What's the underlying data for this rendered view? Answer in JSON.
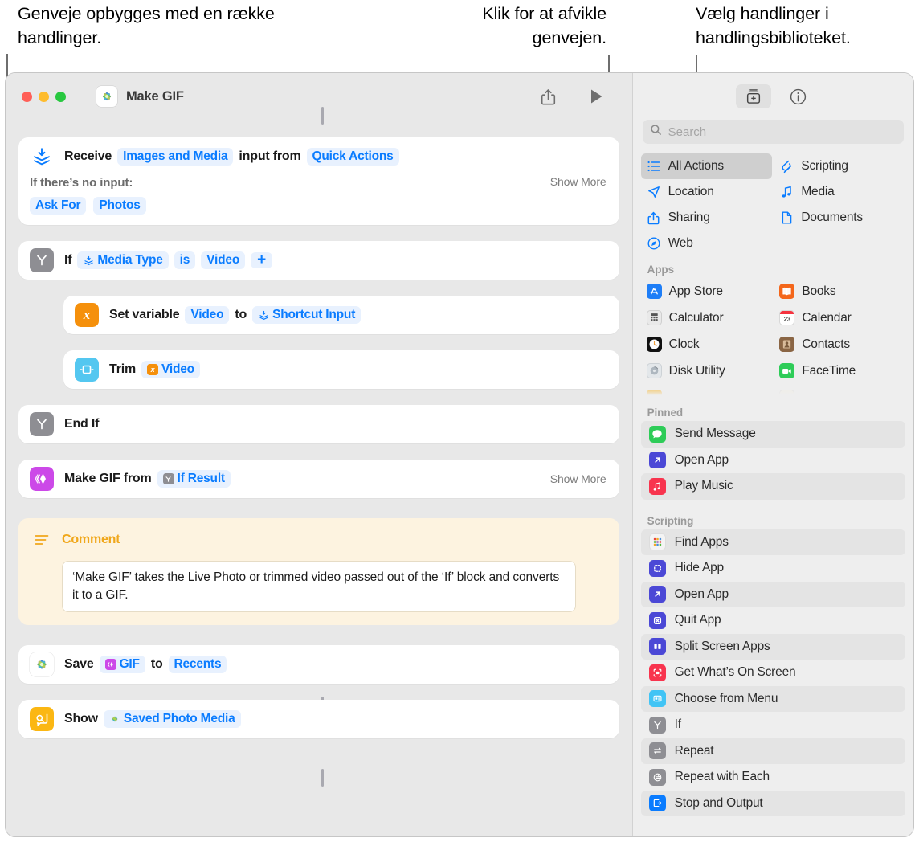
{
  "callouts": {
    "left": "Genveje opbygges med en række handlinger.",
    "middle": "Klik for at afvikle genvejen.",
    "right": "Vælg handlinger i handlingsbiblioteket."
  },
  "window": {
    "title": "Make GIF",
    "app_icon": "photos-icon",
    "traffic_lights": {
      "close": "close-button",
      "minimize": "minimize-button",
      "maximize": "maximize-button"
    },
    "toolbar": {
      "share_label": "share-icon",
      "run_label": "play-icon"
    }
  },
  "actions": [
    {
      "id": "receive",
      "icon": "receive-input-icon",
      "words": [
        "Receive",
        "input from"
      ],
      "tokens": [
        "Images and Media",
        "Quick Actions"
      ],
      "show_more": "Show More",
      "sublabel": "If there’s no input:",
      "subtokens": [
        "Ask For",
        "Photos"
      ]
    },
    {
      "id": "if",
      "icon": "if-icon",
      "label": "If",
      "tokens": [
        "Media Type",
        "is",
        "Video"
      ],
      "add_label": "+"
    },
    {
      "id": "set-variable",
      "icon": "variable-icon",
      "label": "Set variable",
      "mid_word": "to",
      "tokens": [
        "Video",
        "Shortcut Input"
      ]
    },
    {
      "id": "trim",
      "icon": "trim-icon",
      "label": "Trim",
      "tokens": [
        "Video"
      ]
    },
    {
      "id": "end-if",
      "icon": "if-icon",
      "label": "End If"
    },
    {
      "id": "make-gif",
      "icon": "make-gif-icon",
      "label": "Make GIF from",
      "tokens": [
        "If Result"
      ],
      "show_more": "Show More"
    }
  ],
  "comment": {
    "icon": "comment-icon",
    "title": "Comment",
    "body": "‘Make GIF’ takes the Live Photo or trimmed video passed out of the ‘If’ block and converts it to a GIF."
  },
  "actions_tail": [
    {
      "id": "save",
      "icon": "photos-icon",
      "label": "Save",
      "mid_word": "to",
      "tokens": [
        "GIF",
        "Recents"
      ]
    },
    {
      "id": "show",
      "icon": "quick-look-icon",
      "label": "Show",
      "tokens": [
        "Saved Photo Media"
      ]
    }
  ],
  "library": {
    "toolbar": {
      "library_button": "action-library-icon",
      "info_button": "info-icon"
    },
    "search": {
      "placeholder": "Search",
      "value": ""
    },
    "categories": [
      {
        "label": "All Actions",
        "icon": "list-icon",
        "selected": true
      },
      {
        "label": "Scripting",
        "icon": "scripting-icon",
        "selected": false
      },
      {
        "label": "Location",
        "icon": "location-arrow-icon",
        "selected": false
      },
      {
        "label": "Media",
        "icon": "music-note-icon",
        "selected": false
      },
      {
        "label": "Sharing",
        "icon": "share-icon",
        "selected": false
      },
      {
        "label": "Documents",
        "icon": "document-icon",
        "selected": false
      },
      {
        "label": "Web",
        "icon": "safari-compass-icon",
        "selected": false
      }
    ],
    "apps_header": "Apps",
    "apps": [
      {
        "label": "App Store",
        "icon": "app-store-icon"
      },
      {
        "label": "Books",
        "icon": "books-icon"
      },
      {
        "label": "Calculator",
        "icon": "calculator-icon"
      },
      {
        "label": "Calendar",
        "icon": "calendar-icon",
        "day": "23"
      },
      {
        "label": "Clock",
        "icon": "clock-icon"
      },
      {
        "label": "Contacts",
        "icon": "contacts-icon"
      },
      {
        "label": "Disk Utility",
        "icon": "disk-utility-icon"
      },
      {
        "label": "FaceTime",
        "icon": "facetime-icon"
      }
    ],
    "pinned_header": "Pinned",
    "pinned": [
      {
        "label": "Send Message",
        "icon": "messages-icon"
      },
      {
        "label": "Open App",
        "icon": "open-app-icon"
      },
      {
        "label": "Play Music",
        "icon": "music-icon"
      }
    ],
    "scripting_header": "Scripting",
    "scripting": [
      {
        "label": "Find Apps",
        "icon": "find-apps-icon"
      },
      {
        "label": "Hide App",
        "icon": "hide-app-icon"
      },
      {
        "label": "Open App",
        "icon": "open-app-icon"
      },
      {
        "label": "Quit App",
        "icon": "quit-app-icon"
      },
      {
        "label": "Split Screen Apps",
        "icon": "split-screen-icon"
      },
      {
        "label": "Get What’s On Screen",
        "icon": "get-screen-icon"
      },
      {
        "label": "Choose from Menu",
        "icon": "choose-menu-icon"
      },
      {
        "label": "If",
        "icon": "if-icon"
      },
      {
        "label": "Repeat",
        "icon": "repeat-icon"
      },
      {
        "label": "Repeat with Each",
        "icon": "repeat-each-icon"
      },
      {
        "label": "Stop and Output",
        "icon": "stop-output-icon"
      }
    ]
  },
  "colors": {
    "accent_blue": "#0a7cff",
    "token_bg": "#e8f1fe",
    "gray_icon": "#8e8e93",
    "orange": "#f5900c",
    "cyan": "#54c7f0",
    "purple": "#cc49e8",
    "yellow": "#fbb713",
    "comment_bg": "#fdf3e0",
    "comment_text": "#f0a71b",
    "window_bg": "#e8e8e8",
    "library_bg": "#eeeeee"
  }
}
